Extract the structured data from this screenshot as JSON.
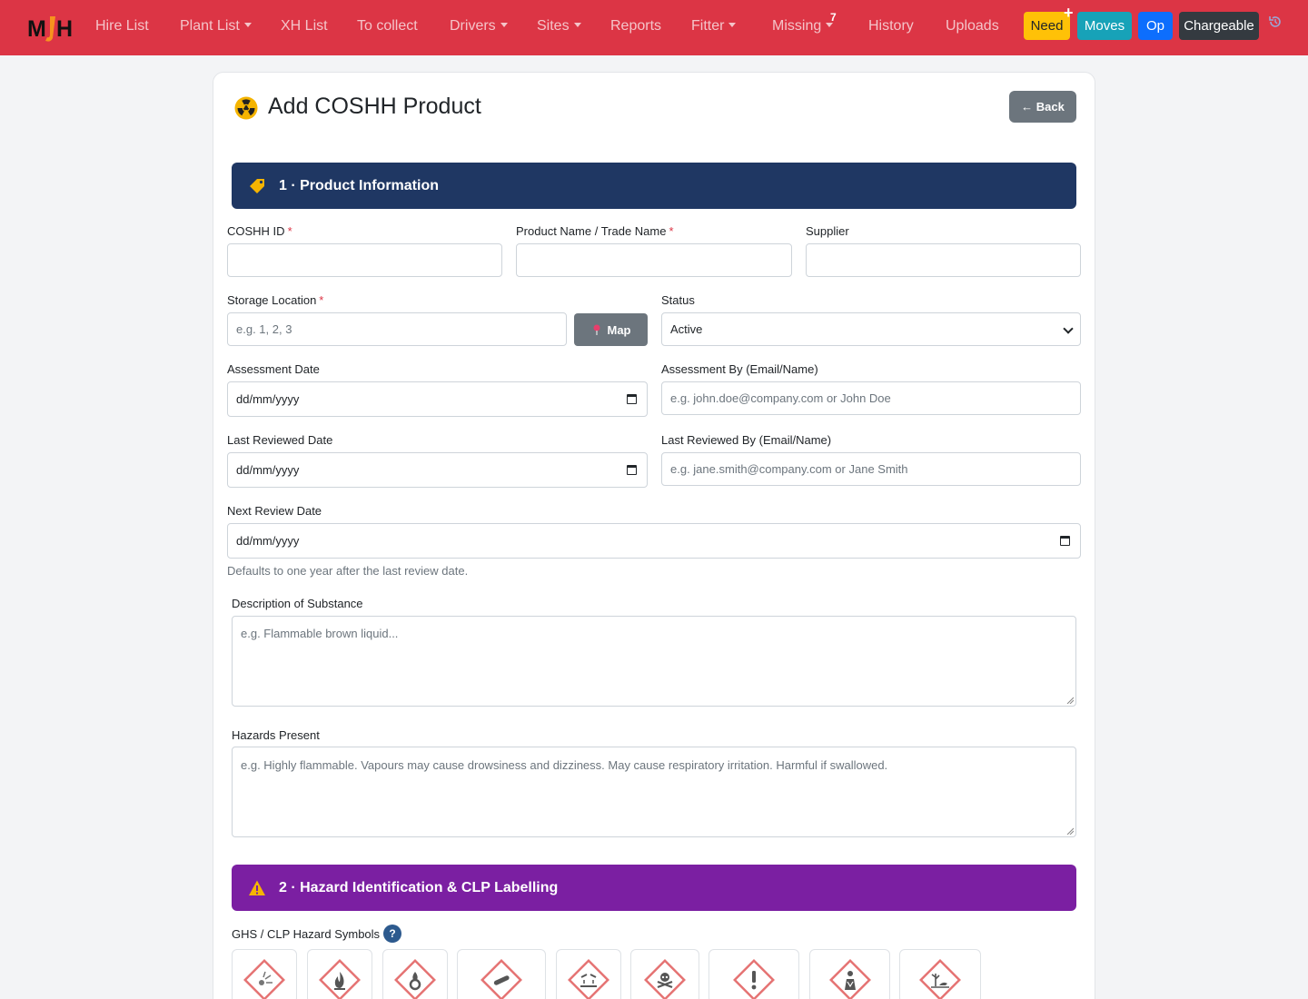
{
  "nav": {
    "items": [
      {
        "label": "Hire List",
        "dropdown": false
      },
      {
        "label": "Plant List",
        "dropdown": true
      },
      {
        "label": "XH List",
        "dropdown": false
      },
      {
        "label": "To collect",
        "dropdown": false
      },
      {
        "label": "Drivers",
        "dropdown": true
      },
      {
        "label": "Sites",
        "dropdown": true
      },
      {
        "label": "Reports",
        "dropdown": false
      },
      {
        "label": "Fitter",
        "dropdown": true
      },
      {
        "label": "Missing",
        "dropdown": true
      },
      {
        "label": "History",
        "dropdown": false
      },
      {
        "label": "Uploads",
        "dropdown": false
      }
    ],
    "missing_badge": "7",
    "buttons": {
      "need": "Need",
      "need_plus": "+",
      "moves": "Moves",
      "op": "Op",
      "chargeable": "Chargeable"
    },
    "colors": {
      "bar": "#dc3545",
      "need": "#ffc107",
      "moves": "#17a2b8",
      "op": "#0d6efd",
      "chargeable": "#343a40"
    }
  },
  "page": {
    "title": "Add COSHH Product",
    "back_label": "← Back"
  },
  "section1": {
    "title": "1 · Product Information",
    "color": "#1f3763"
  },
  "form": {
    "coshh_id": {
      "label": "COSHH ID",
      "value": ""
    },
    "product_name": {
      "label": "Product Name / Trade Name",
      "value": ""
    },
    "supplier": {
      "label": "Supplier",
      "value": ""
    },
    "storage_location": {
      "label": "Storage Location",
      "placeholder": "e.g. 1, 2, 3"
    },
    "map_label": "Map",
    "status": {
      "label": "Status",
      "value": "Active"
    },
    "assessment_date": {
      "label": "Assessment Date",
      "value": "dd/mm/yyyy"
    },
    "assessment_by": {
      "label": "Assessment By (Email/Name)",
      "placeholder": "e.g. john.doe@company.com or John Doe"
    },
    "last_reviewed_date": {
      "label": "Last Reviewed Date",
      "value": "dd/mm/yyyy"
    },
    "last_reviewed_by": {
      "label": "Last Reviewed By (Email/Name)",
      "placeholder": "e.g. jane.smith@company.com or Jane Smith"
    },
    "next_review_date": {
      "label": "Next Review Date",
      "value": "dd/mm/yyyy",
      "hint": "Defaults to one year after the last review date."
    },
    "description": {
      "label": "Description of Substance",
      "placeholder": "e.g. Flammable brown liquid..."
    },
    "hazards": {
      "label": "Hazards Present",
      "placeholder": "e.g. Highly flammable. Vapours may cause drowsiness and dizziness. May cause respiratory irritation. Harmful if swallowed."
    },
    "required_mark": "*"
  },
  "section2": {
    "title": "2 · Hazard Identification & CLP Labelling",
    "color": "#7b1fa2"
  },
  "ghs": {
    "label": "GHS / CLP Hazard Symbols",
    "help": "?",
    "symbols": [
      "explosive-icon",
      "flammable-icon",
      "oxidising-icon",
      "gas-cylinder-icon",
      "corrosive-icon",
      "acute-toxicity-icon",
      "health-hazard-exclamation-icon",
      "serious-health-hazard-icon",
      "environment-hazard-icon"
    ]
  }
}
